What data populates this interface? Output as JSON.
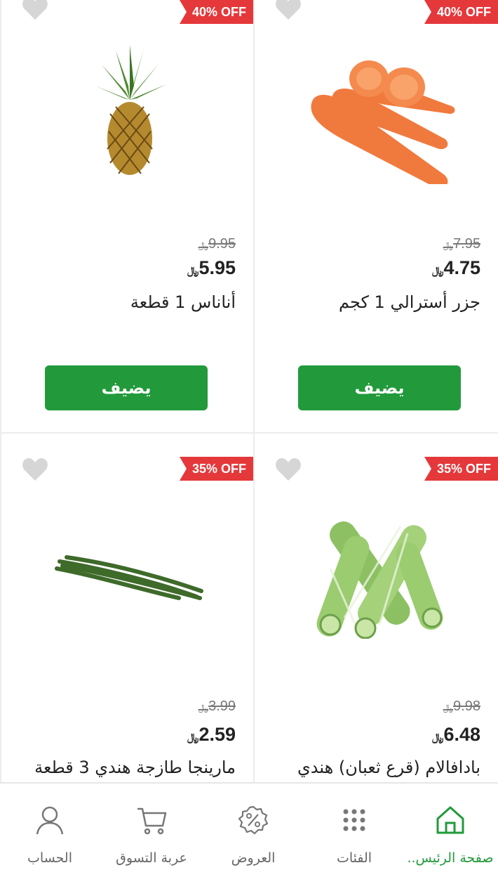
{
  "colors": {
    "accent": "#229a3b",
    "badge": "#e5383b"
  },
  "currency": "﷼",
  "products": [
    {
      "name": "أناناس 1 قطعة",
      "old_price": "9.95",
      "price": "5.95",
      "discount": "40% OFF",
      "add_label": "يضيف",
      "image": "pineapple"
    },
    {
      "name": "جزر أسترالي 1 كجم",
      "old_price": "7.95",
      "price": "4.75",
      "discount": "40% OFF",
      "add_label": "يضيف",
      "image": "carrots"
    },
    {
      "name": "مارينجا طازجة هندي 3 قطعة",
      "old_price": "3.99",
      "price": "2.59",
      "discount": "35% OFF",
      "image": "drumsticks"
    },
    {
      "name": "بادافالام (قرع ثعبان) هندي",
      "old_price": "9.98",
      "price": "6.48",
      "discount": "35% OFF",
      "image": "snake-gourd"
    }
  ],
  "nav": [
    {
      "label": "الحساب",
      "icon": "user-icon"
    },
    {
      "label": "عربة التسوق",
      "icon": "cart-icon"
    },
    {
      "label": "العروض",
      "icon": "offers-icon"
    },
    {
      "label": "الفئات",
      "icon": "grid-icon"
    },
    {
      "label": "صفحة الرئيس..",
      "icon": "home-icon",
      "active": true
    }
  ]
}
